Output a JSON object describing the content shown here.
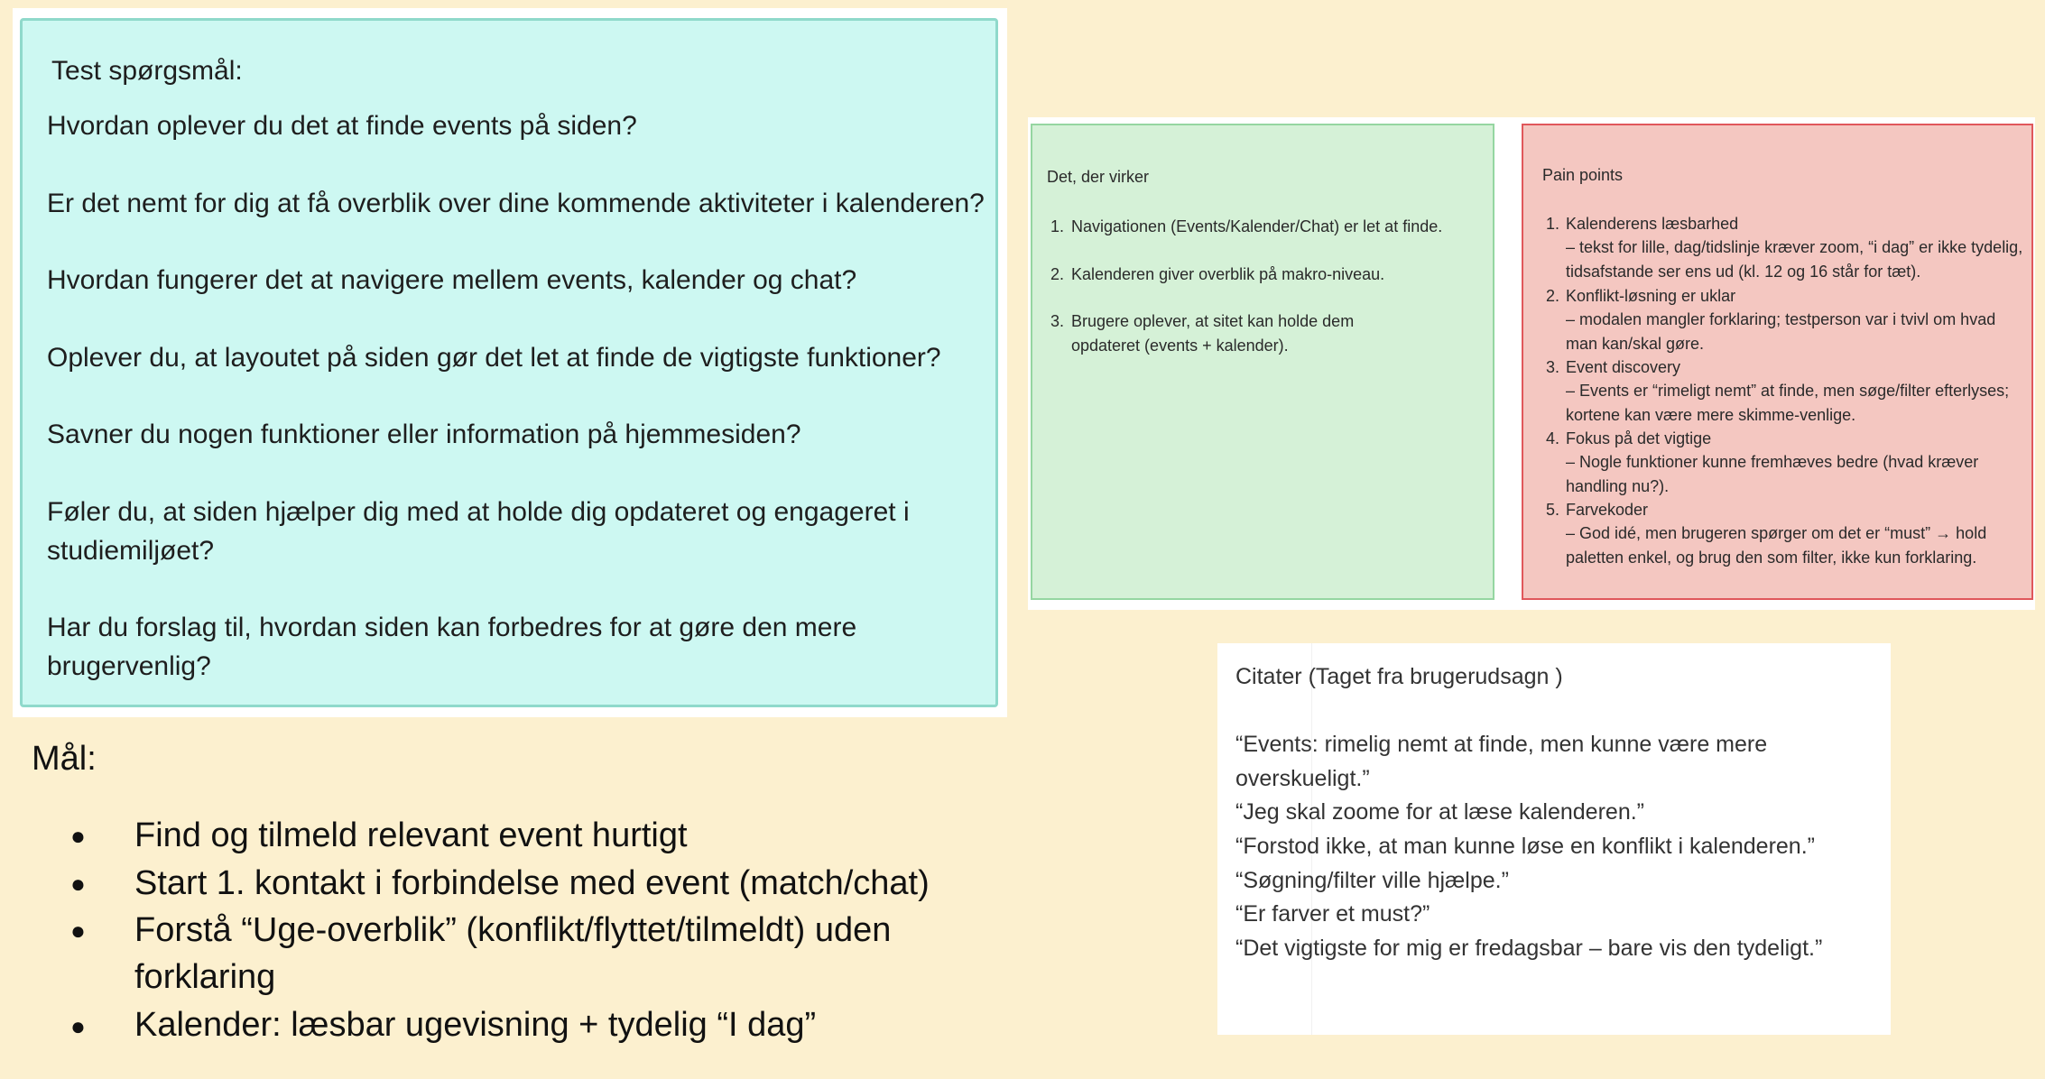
{
  "test_questions": {
    "title": "Test spørgsmål:",
    "questions": [
      "Hvordan oplever du det at finde events på siden?",
      "Er det nemt for dig at få overblik over dine kommende aktiviteter i kalenderen?",
      "Hvordan fungerer det at navigere mellem events, kalender og chat?",
      "Oplever du, at layoutet på siden gør det let at finde de vigtigste funktioner?",
      "Savner du nogen funktioner eller information på hjemmesiden?",
      "Føler du, at siden hjælper dig med at holde dig opdateret og engageret i studiemiljøet?",
      "Har du forslag til, hvordan siden kan forbedres for at gøre den mere brugervenlig?"
    ]
  },
  "goals": {
    "title": "Mål:",
    "items": [
      "Find og tilmeld relevant event hurtigt",
      "Start 1. kontakt i forbindelse med event (match/chat)",
      "Forstå “Uge-overblik” (konflikt/flyttet/tilmeldt) uden forklaring",
      "Kalender: læsbar ugevisning + tydelig “I dag”"
    ]
  },
  "works": {
    "title": "Det, der virker",
    "items": [
      "Navigationen (Events/Kalender/Chat) er let at finde.",
      "Kalenderen giver overblik på makro-niveau.",
      "Brugere oplever, at sitet kan holde dem opdateret (events + kalender)."
    ]
  },
  "pain_points": {
    "title": "Pain points",
    "items": [
      {
        "heading": "Kalenderens læsbarhed",
        "detail": "– tekst for lille, dag/tidslinje kræver zoom, “i dag” er ikke tydelig, tidsafstande ser ens ud (kl. 12 og 16 står for tæt)."
      },
      {
        "heading": "Konflikt-løsning er uklar",
        "detail": "– modalen mangler forklaring; testperson var i tvivl om hvad man kan/skal gøre."
      },
      {
        "heading": "Event discovery",
        "detail": "– Events er “rimeligt nemt” at finde, men søge/filter efterlyses; kortene kan være mere skimme-venlige."
      },
      {
        "heading": "Fokus på det vigtige",
        "detail": "– Nogle funktioner kunne fremhæves bedre (hvad kræver handling nu?)."
      },
      {
        "heading": "Farvekoder",
        "detail": "– God idé, men brugeren spørger om det er “must” → hold paletten enkel, og brug den som filter, ikke kun forklaring."
      }
    ]
  },
  "quotes": {
    "title": "Citater (Taget fra brugerudsagn )",
    "items": [
      "“Events: rimelig nemt at finde, men kunne være mere overskueligt.”",
      "“Jeg skal zoome for at læse kalenderen.”",
      "“Forstod ikke, at man kunne løse en konflikt i kalenderen.”",
      "“Søgning/filter ville hjælpe.”",
      "“Er farver et must?”",
      "“Det vigtigste for mig er fredagsbar – bare vis den tydeligt.”"
    ]
  }
}
